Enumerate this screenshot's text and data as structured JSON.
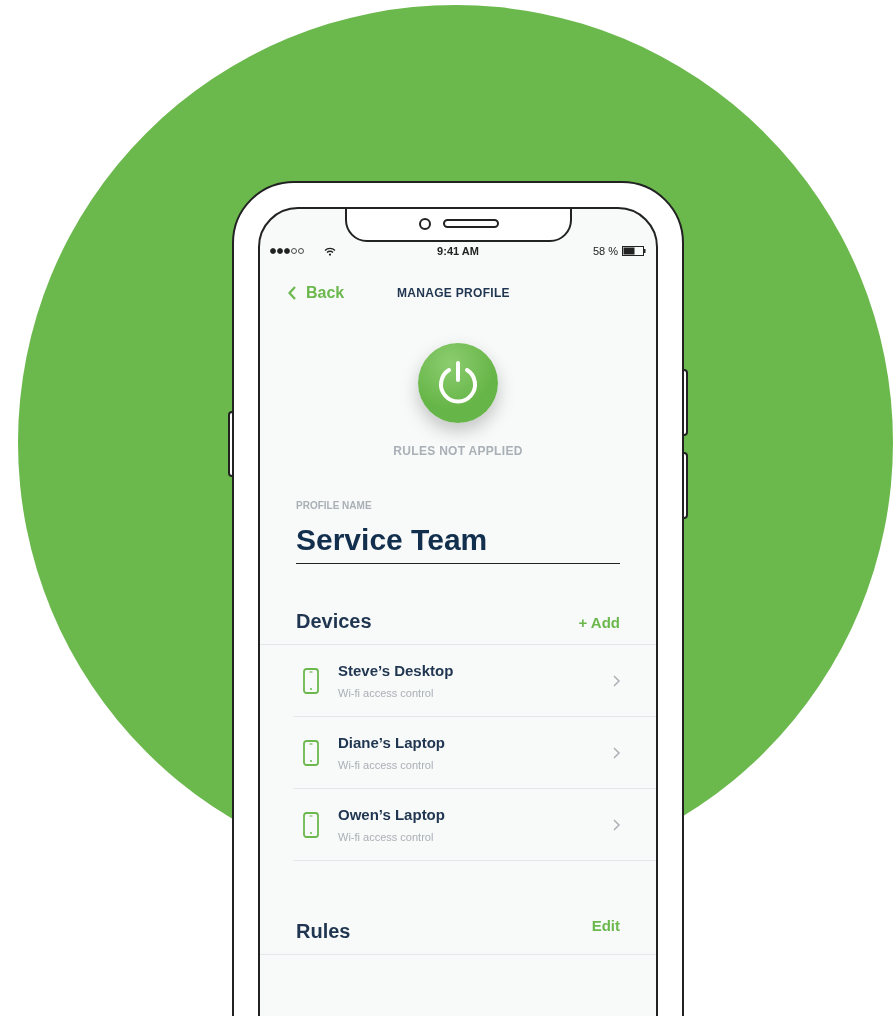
{
  "status_bar": {
    "time": "9:41 AM",
    "battery": "58 %"
  },
  "nav": {
    "back": "Back",
    "title": "MANAGE PROFILE"
  },
  "power": {
    "status": "RULES NOT APPLIED"
  },
  "profile": {
    "label": "PROFILE NAME",
    "value": "Service Team"
  },
  "devices": {
    "title": "Devices",
    "action": "+ Add",
    "items": [
      {
        "name": "Steve’s Desktop",
        "subtitle": "Wi-fi access control"
      },
      {
        "name": "Diane’s Laptop",
        "subtitle": "Wi-fi access control"
      },
      {
        "name": "Owen’s Laptop",
        "subtitle": "Wi-fi access control"
      }
    ]
  },
  "rules": {
    "title": "Rules",
    "action": "Edit"
  }
}
